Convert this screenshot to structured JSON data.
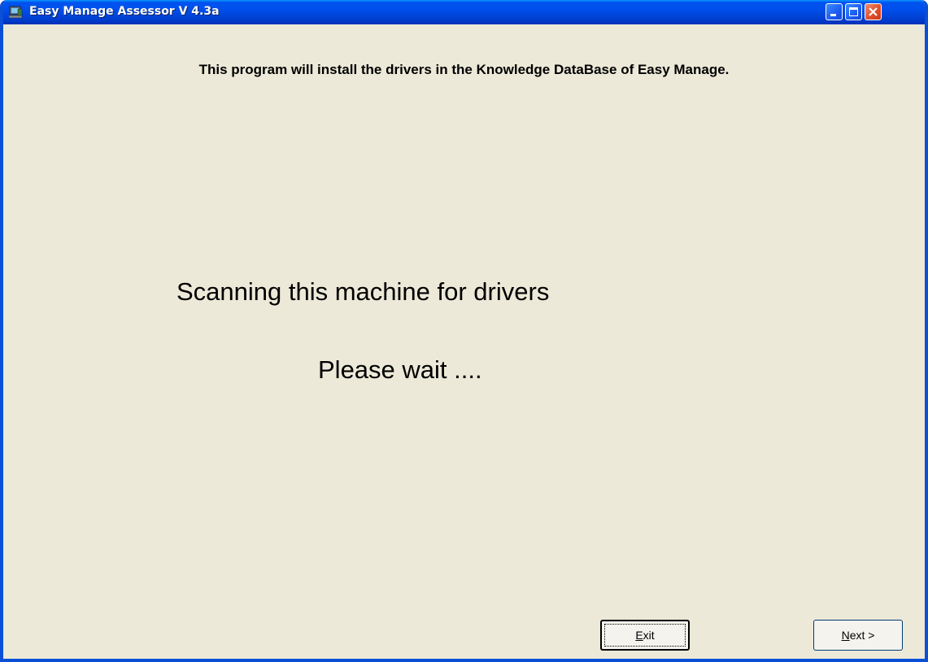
{
  "window": {
    "title": "Easy Manage Assessor V 4.3a",
    "icon": "app-computer-icon",
    "title_bar_color": "#0053EE",
    "client_bg_color": "#ECE9D8"
  },
  "titlebar_buttons": {
    "minimize_icon": "minimize-icon",
    "maximize_icon": "maximize-icon",
    "close_icon": "close-icon"
  },
  "content": {
    "header": "This program will install the drivers in the Knowledge DataBase of Easy Manage.",
    "status_line1": "Scanning this machine for drivers",
    "status_line2": "Please wait ...."
  },
  "buttons": {
    "exit": {
      "mnemonic": "E",
      "rest": "xit"
    },
    "next": {
      "mnemonic": "N",
      "rest": "ext >"
    }
  }
}
